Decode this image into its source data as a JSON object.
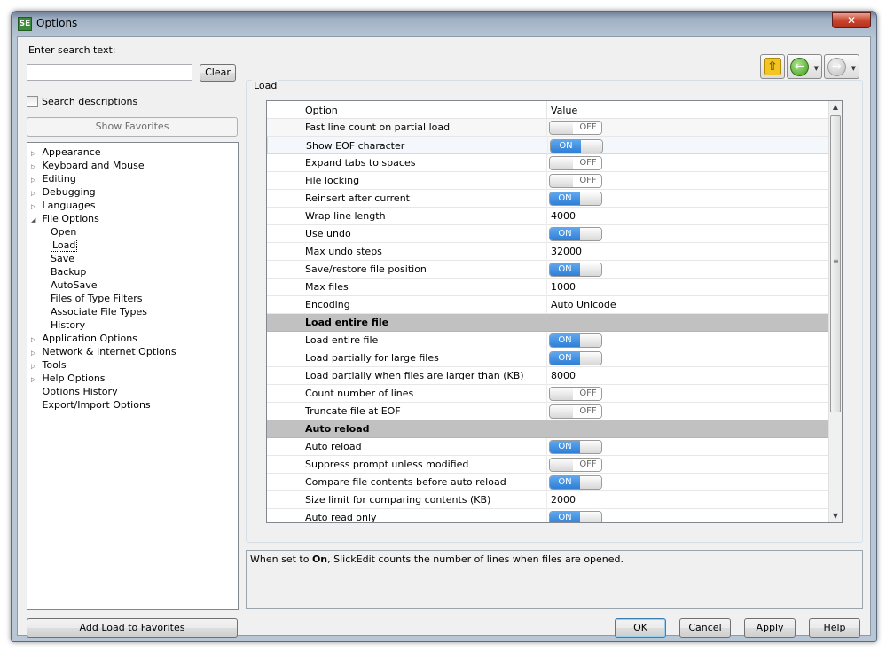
{
  "window": {
    "title": "Options",
    "app_icon": "SE"
  },
  "search": {
    "label": "Enter search text:",
    "value": "",
    "clear_label": "Clear",
    "checkbox_label": "Search descriptions",
    "checked": false
  },
  "show_favorites_label": "Show Favorites",
  "tree": [
    {
      "label": "Appearance",
      "expander": "collapsed"
    },
    {
      "label": "Keyboard and Mouse",
      "expander": "collapsed"
    },
    {
      "label": "Editing",
      "expander": "collapsed"
    },
    {
      "label": "Debugging",
      "expander": "collapsed"
    },
    {
      "label": "Languages",
      "expander": "collapsed"
    },
    {
      "label": "File Options",
      "expander": "expanded"
    },
    {
      "label": "Open",
      "child": true
    },
    {
      "label": "Load",
      "child": true,
      "selected": true
    },
    {
      "label": "Save",
      "child": true
    },
    {
      "label": "Backup",
      "child": true
    },
    {
      "label": "AutoSave",
      "child": true
    },
    {
      "label": "Files of Type Filters",
      "child": true
    },
    {
      "label": "Associate File Types",
      "child": true
    },
    {
      "label": "History",
      "child": true
    },
    {
      "label": "Application Options",
      "expander": "collapsed"
    },
    {
      "label": "Network & Internet Options",
      "expander": "collapsed"
    },
    {
      "label": "Tools",
      "expander": "collapsed"
    },
    {
      "label": "Help Options",
      "expander": "collapsed"
    },
    {
      "label": "Options History",
      "expander": "none"
    },
    {
      "label": "Export/Import Options",
      "expander": "none"
    }
  ],
  "add_favorites_label": "Add Load to Favorites",
  "group_label": "Load",
  "grid": {
    "col_option": "Option",
    "col_value": "Value",
    "rows": [
      {
        "option": "Fast line count on partial load",
        "toggle": "OFF"
      },
      {
        "option": "Show EOF character",
        "toggle": "ON"
      },
      {
        "option": "Expand tabs to spaces",
        "toggle": "OFF"
      },
      {
        "option": "File locking",
        "toggle": "OFF"
      },
      {
        "option": "Reinsert after current",
        "toggle": "ON"
      },
      {
        "option": "Wrap line length",
        "value": "4000"
      },
      {
        "option": "Use undo",
        "toggle": "ON"
      },
      {
        "option": "Max undo steps",
        "value": "32000"
      },
      {
        "option": "Save/restore file position",
        "toggle": "ON"
      },
      {
        "option": "Max files",
        "value": "1000"
      },
      {
        "option": "Encoding",
        "value": "Auto Unicode"
      },
      {
        "option": "Load entire file",
        "section": true
      },
      {
        "option": "Load entire file",
        "toggle": "ON"
      },
      {
        "option": "Load partially for large files",
        "toggle": "ON"
      },
      {
        "option": "Load partially when files are larger than (KB)",
        "value": "8000"
      },
      {
        "option": "Count number of lines",
        "toggle": "OFF"
      },
      {
        "option": "Truncate file at EOF",
        "toggle": "OFF"
      },
      {
        "option": "Auto reload",
        "section": true
      },
      {
        "option": "Auto reload",
        "toggle": "ON"
      },
      {
        "option": "Suppress prompt unless modified",
        "toggle": "OFF"
      },
      {
        "option": "Compare file contents before auto reload",
        "toggle": "ON"
      },
      {
        "option": "Size limit for comparing contents (KB)",
        "value": "2000"
      },
      {
        "option": "Auto read only",
        "toggle": "ON"
      }
    ]
  },
  "description": {
    "prefix": "When set to ",
    "bold": "On",
    "suffix": ", SlickEdit counts the number of lines when files are opened."
  },
  "buttons": {
    "ok": "OK",
    "cancel": "Cancel",
    "apply": "Apply",
    "help": "Help"
  },
  "toggle_labels": {
    "on": "ON",
    "off": "OFF"
  },
  "colors": {
    "toggle_on": "#2f7fd6",
    "section_bg": "#c1c1c1",
    "close_button": "#c9452e"
  }
}
